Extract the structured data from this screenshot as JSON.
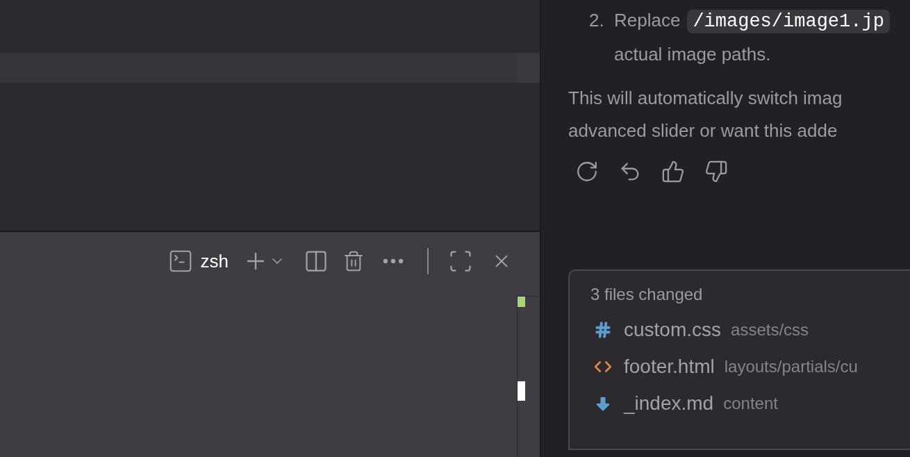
{
  "terminal": {
    "shell": "zsh"
  },
  "chat": {
    "list_item": {
      "number": "2.",
      "lead": "Replace",
      "code": "/images/image1.jp",
      "continuation": "actual image paths."
    },
    "paragraph_lines": [
      "This will automatically switch imag",
      "advanced slider or want this adde"
    ]
  },
  "changes": {
    "title": "3 files changed",
    "files": [
      {
        "name": "custom.css",
        "path": "assets/css",
        "kind": "css"
      },
      {
        "name": "footer.html",
        "path": "layouts/partials/cu",
        "kind": "html"
      },
      {
        "name": "_index.md",
        "path": "content",
        "kind": "markdown"
      }
    ]
  }
}
